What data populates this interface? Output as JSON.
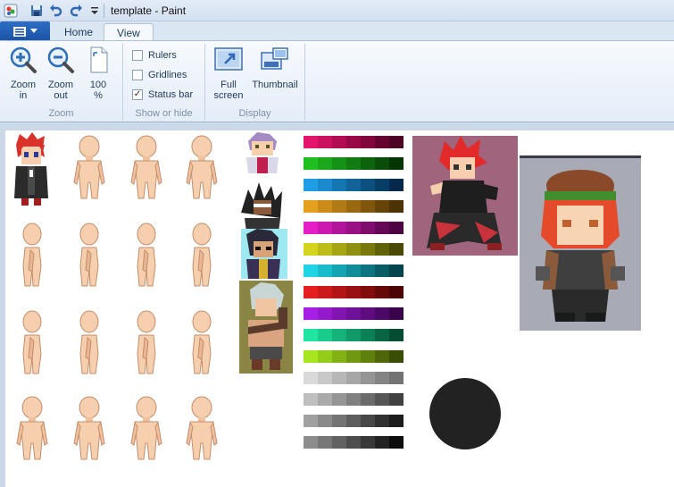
{
  "window": {
    "title": "template - Paint"
  },
  "qat": {
    "icons": [
      "save-icon",
      "undo-icon",
      "redo-icon",
      "customize-icon"
    ]
  },
  "tabs": [
    {
      "label": "Home",
      "active": false
    },
    {
      "label": "View",
      "active": true
    }
  ],
  "ribbon": {
    "zoom_group": {
      "label": "Zoom",
      "zoom_in": "Zoom\nin",
      "zoom_out": "Zoom\nout",
      "hundred": "100\n%"
    },
    "show_group": {
      "label": "Show or hide",
      "rulers": {
        "label": "Rulers",
        "checked": false
      },
      "gridlines": {
        "label": "Gridlines",
        "checked": false
      },
      "statusbar": {
        "label": "Status bar",
        "checked": true
      }
    },
    "display_group": {
      "label": "Display",
      "fullscreen": "Full\nscreen",
      "thumbnail": "Thumbnail"
    }
  },
  "colors": {
    "skin": "#f5cfae",
    "skin_shade": "#d49a74",
    "hair_red": "#d8322a",
    "swatch_rows": [
      [
        "#e5146c",
        "#cc1060",
        "#b20c54",
        "#990948",
        "#80063c",
        "#660430",
        "#4d0224"
      ],
      [
        "#1fbf1f",
        "#1aa81a",
        "#159115",
        "#117a11",
        "#0c630c",
        "#084d08",
        "#043604"
      ],
      [
        "#1f9ee5",
        "#1a8acc",
        "#1577b2",
        "#116399",
        "#0c5080",
        "#083d66",
        "#04294d"
      ],
      [
        "#e5a01f",
        "#cc8c1a",
        "#b27a15",
        "#996811",
        "#80560c",
        "#664408",
        "#4d3204"
      ],
      [
        "#e51fc6",
        "#cc1ab0",
        "#b2159a",
        "#991184",
        "#800c6e",
        "#660858",
        "#4d0442"
      ],
      [
        "#d4d41f",
        "#bdbd1a",
        "#a6a615",
        "#8f8f11",
        "#78780c",
        "#616108",
        "#4a4a04"
      ],
      [
        "#1fd4e5",
        "#1abccc",
        "#15a4b2",
        "#118c99",
        "#0c7480",
        "#085c66",
        "#04444d"
      ],
      [
        "#e51f1f",
        "#cc1a1a",
        "#b21515",
        "#991111",
        "#800c0c",
        "#660808",
        "#4d0404"
      ],
      [
        "#a61fe5",
        "#941acc",
        "#8215b2",
        "#701199",
        "#5e0c80",
        "#4c0866",
        "#3a044d"
      ],
      [
        "#1fe5a0",
        "#1acc8c",
        "#15b27a",
        "#119968",
        "#0c8056",
        "#086644",
        "#044d32"
      ],
      [
        "#a6e51f",
        "#94cc1a",
        "#82b215",
        "#709911",
        "#5e800c",
        "#4c6608",
        "#3a4d04"
      ],
      [
        "#d9d9d9",
        "#c8c8c8",
        "#b7b7b7",
        "#a6a6a6",
        "#959595",
        "#848484",
        "#737373"
      ],
      [
        "#bfbfbf",
        "#aaaaaa",
        "#959595",
        "#808080",
        "#6b6b6b",
        "#565656",
        "#414141"
      ],
      [
        "#a0a0a0",
        "#8a8a8a",
        "#747474",
        "#5e5e5e",
        "#484848",
        "#323232",
        "#1c1c1c"
      ],
      [
        "#8c8c8c",
        "#777777",
        "#626262",
        "#4d4d4d",
        "#383838",
        "#232323",
        "#0e0e0e"
      ]
    ]
  }
}
